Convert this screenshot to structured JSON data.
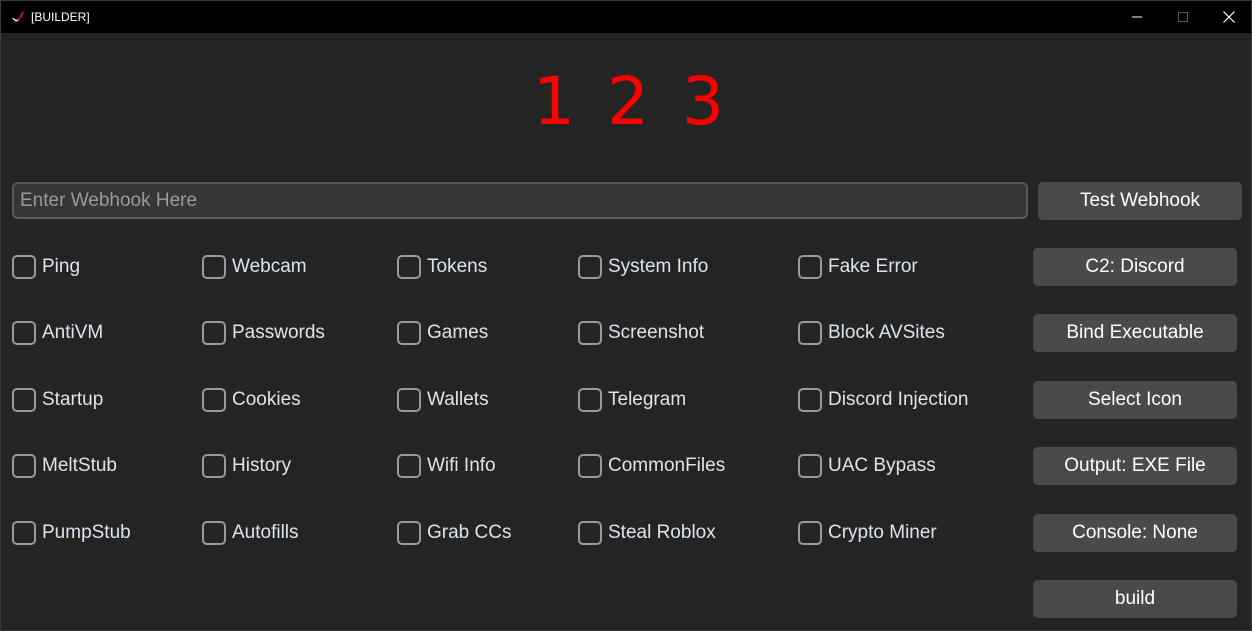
{
  "window": {
    "title": "[BUILDER]"
  },
  "steps": [
    "1",
    "2",
    "3"
  ],
  "webhook": {
    "placeholder": "Enter Webhook Here",
    "value": ""
  },
  "buttons": {
    "test_webhook": "Test Webhook",
    "c2": "C2: Discord",
    "bind": "Bind Executable",
    "icon": "Select Icon",
    "output": "Output: EXE File",
    "console": "Console: None",
    "build": "build"
  },
  "options": [
    [
      "Ping",
      "Webcam",
      "Tokens",
      "System Info",
      "Fake Error"
    ],
    [
      "AntiVM",
      "Passwords",
      "Games",
      "Screenshot",
      "Block AVSites"
    ],
    [
      "Startup",
      "Cookies",
      "Wallets",
      "Telegram",
      "Discord Injection"
    ],
    [
      "MeltStub",
      "History",
      "Wifi Info",
      "CommonFiles",
      "UAC Bypass"
    ],
    [
      "PumpStub",
      "Autofills",
      "Grab CCs",
      "Steal Roblox",
      "Crypto Miner"
    ]
  ],
  "colors": {
    "background": "#242424",
    "titlebar": "#000000",
    "step_numbers": "#ff0000",
    "button": "#4a4a4a",
    "text": "#dce4ee",
    "app_icon": "#e0102a"
  },
  "icons": {
    "app": "app-logo-icon",
    "minimize": "minimize-icon",
    "maximize": "maximize-icon",
    "close": "close-icon"
  }
}
